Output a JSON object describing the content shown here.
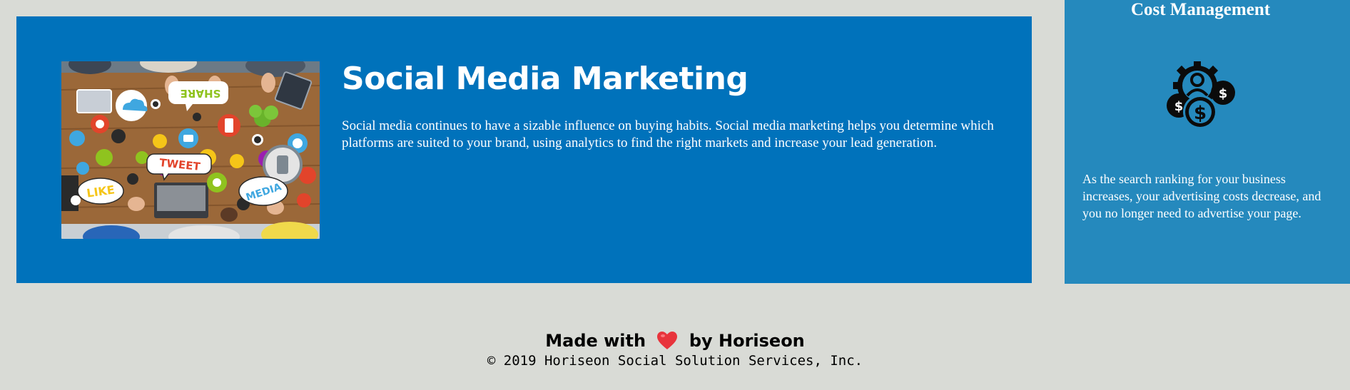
{
  "section": {
    "title": "Social Media Marketing",
    "description": "Social media continues to have a sizable influence on buying habits. Social media marketing helps you determine which platforms are suited to your brand, using analytics to find the right markets and increase your lead generation.",
    "image": {
      "alt": "social media icons over a busy table",
      "bubble_texts": {
        "share": "SHARE",
        "tweet": "TWEET",
        "like": "LIKE",
        "media": "MEDIA"
      }
    }
  },
  "benefit": {
    "title": "Cost Management",
    "icon": "money-gear-icon",
    "text": "As the search ranking for your business increases, your advertising costs decrease, and you no longer need to advertise your page."
  },
  "footer": {
    "made_prefix": "Made with",
    "heart_icon": "heart-icon",
    "made_suffix": "by Horiseon",
    "copyright": "© 2019 Horiseon Social Solution Services, Inc."
  },
  "colors": {
    "page_background": "#d9dbd6",
    "section_background": "#0072bb",
    "benefit_background": "#2589bd",
    "heart": "#e8343c"
  }
}
